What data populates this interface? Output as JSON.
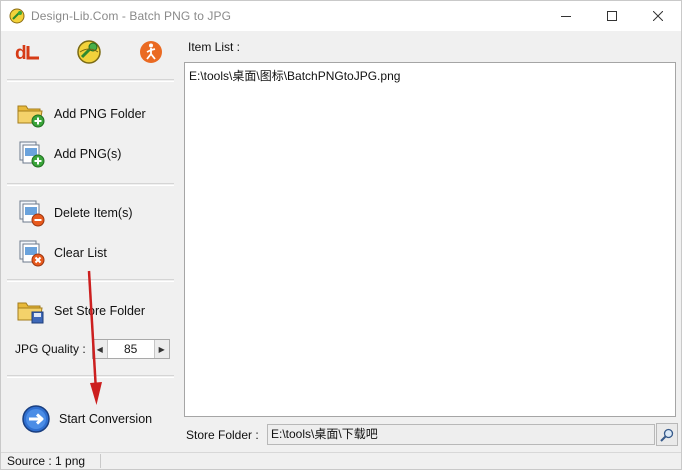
{
  "window": {
    "title": "Design-Lib.Com - Batch PNG to JPG",
    "controls": [
      "minimize",
      "maximize",
      "close"
    ]
  },
  "toolbar_icons": [
    {
      "name": "design-lib-logo",
      "text": "dL",
      "color": "#d63b16"
    },
    {
      "name": "help-globe-icon"
    },
    {
      "name": "about-runner-icon",
      "color": "#e25c1b"
    }
  ],
  "sidebar": {
    "add_png_folder": "Add PNG Folder",
    "add_pngs": "Add PNG(s)",
    "delete_items": "Delete Item(s)",
    "clear_list": "Clear List",
    "set_store_folder": "Set Store Folder",
    "jpg_quality_label": "JPG Quality :",
    "jpg_quality_value": "85",
    "start_conversion": "Start Conversion"
  },
  "main": {
    "item_list_label": "Item List :",
    "items": [
      "E:\\tools\\桌面\\图标\\BatchPNGtoJPG.png"
    ],
    "store_folder_label": "Store Folder :",
    "store_folder_value": "E:\\tools\\桌面\\下载吧"
  },
  "status": {
    "source": "Source : 1  png"
  },
  "colors": {
    "accent_arrow": "#cc1f1f",
    "folder": "#e8b93a",
    "add_green": "#3aa53a",
    "delete_orange": "#e85a1d",
    "start_blue": "#2f6fd0"
  }
}
